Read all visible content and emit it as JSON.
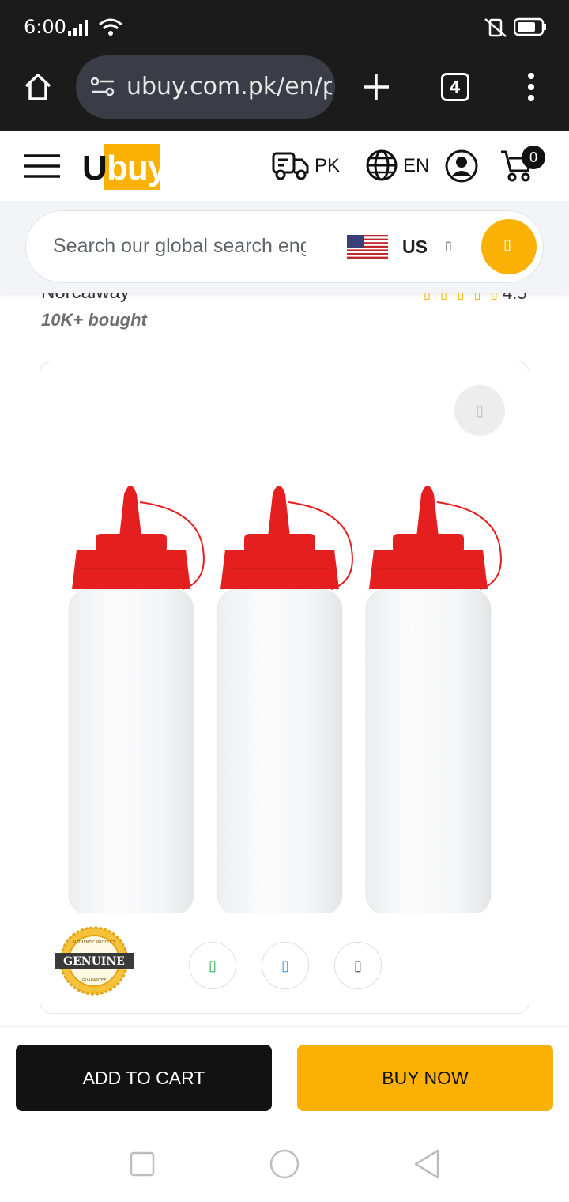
{
  "status_bar": {
    "time": "6:00"
  },
  "browser": {
    "url": "ubuy.com.pk/en/product",
    "tab_count": "4"
  },
  "header": {
    "logo_u": "U",
    "logo_buy": "buy",
    "shipping_region": "PK",
    "language": "EN",
    "cart_count": "0"
  },
  "search": {
    "placeholder": "Search our global search engine",
    "country": "US",
    "dropdown_glyph": "▯",
    "button_glyph": "▯"
  },
  "product": {
    "brand": "Norcalway",
    "rating": "4.5",
    "stars_glyphs": "▯ ▯ ▯ ▯ ▯",
    "bought": "10K+ bought",
    "wishlist_glyph": "▯",
    "thumb_glyphs": [
      "▯",
      "▯",
      "▯"
    ],
    "badge": {
      "text": "GENUINE",
      "top": "AUTHENTIC PRODUCT",
      "bottom": "GUARANTEE"
    }
  },
  "actions": {
    "add_to_cart": "ADD TO CART",
    "buy_now": "BUY NOW"
  },
  "colors": {
    "accent": "#fbb103",
    "dark": "#121212",
    "cap_red": "#e51f1f"
  }
}
